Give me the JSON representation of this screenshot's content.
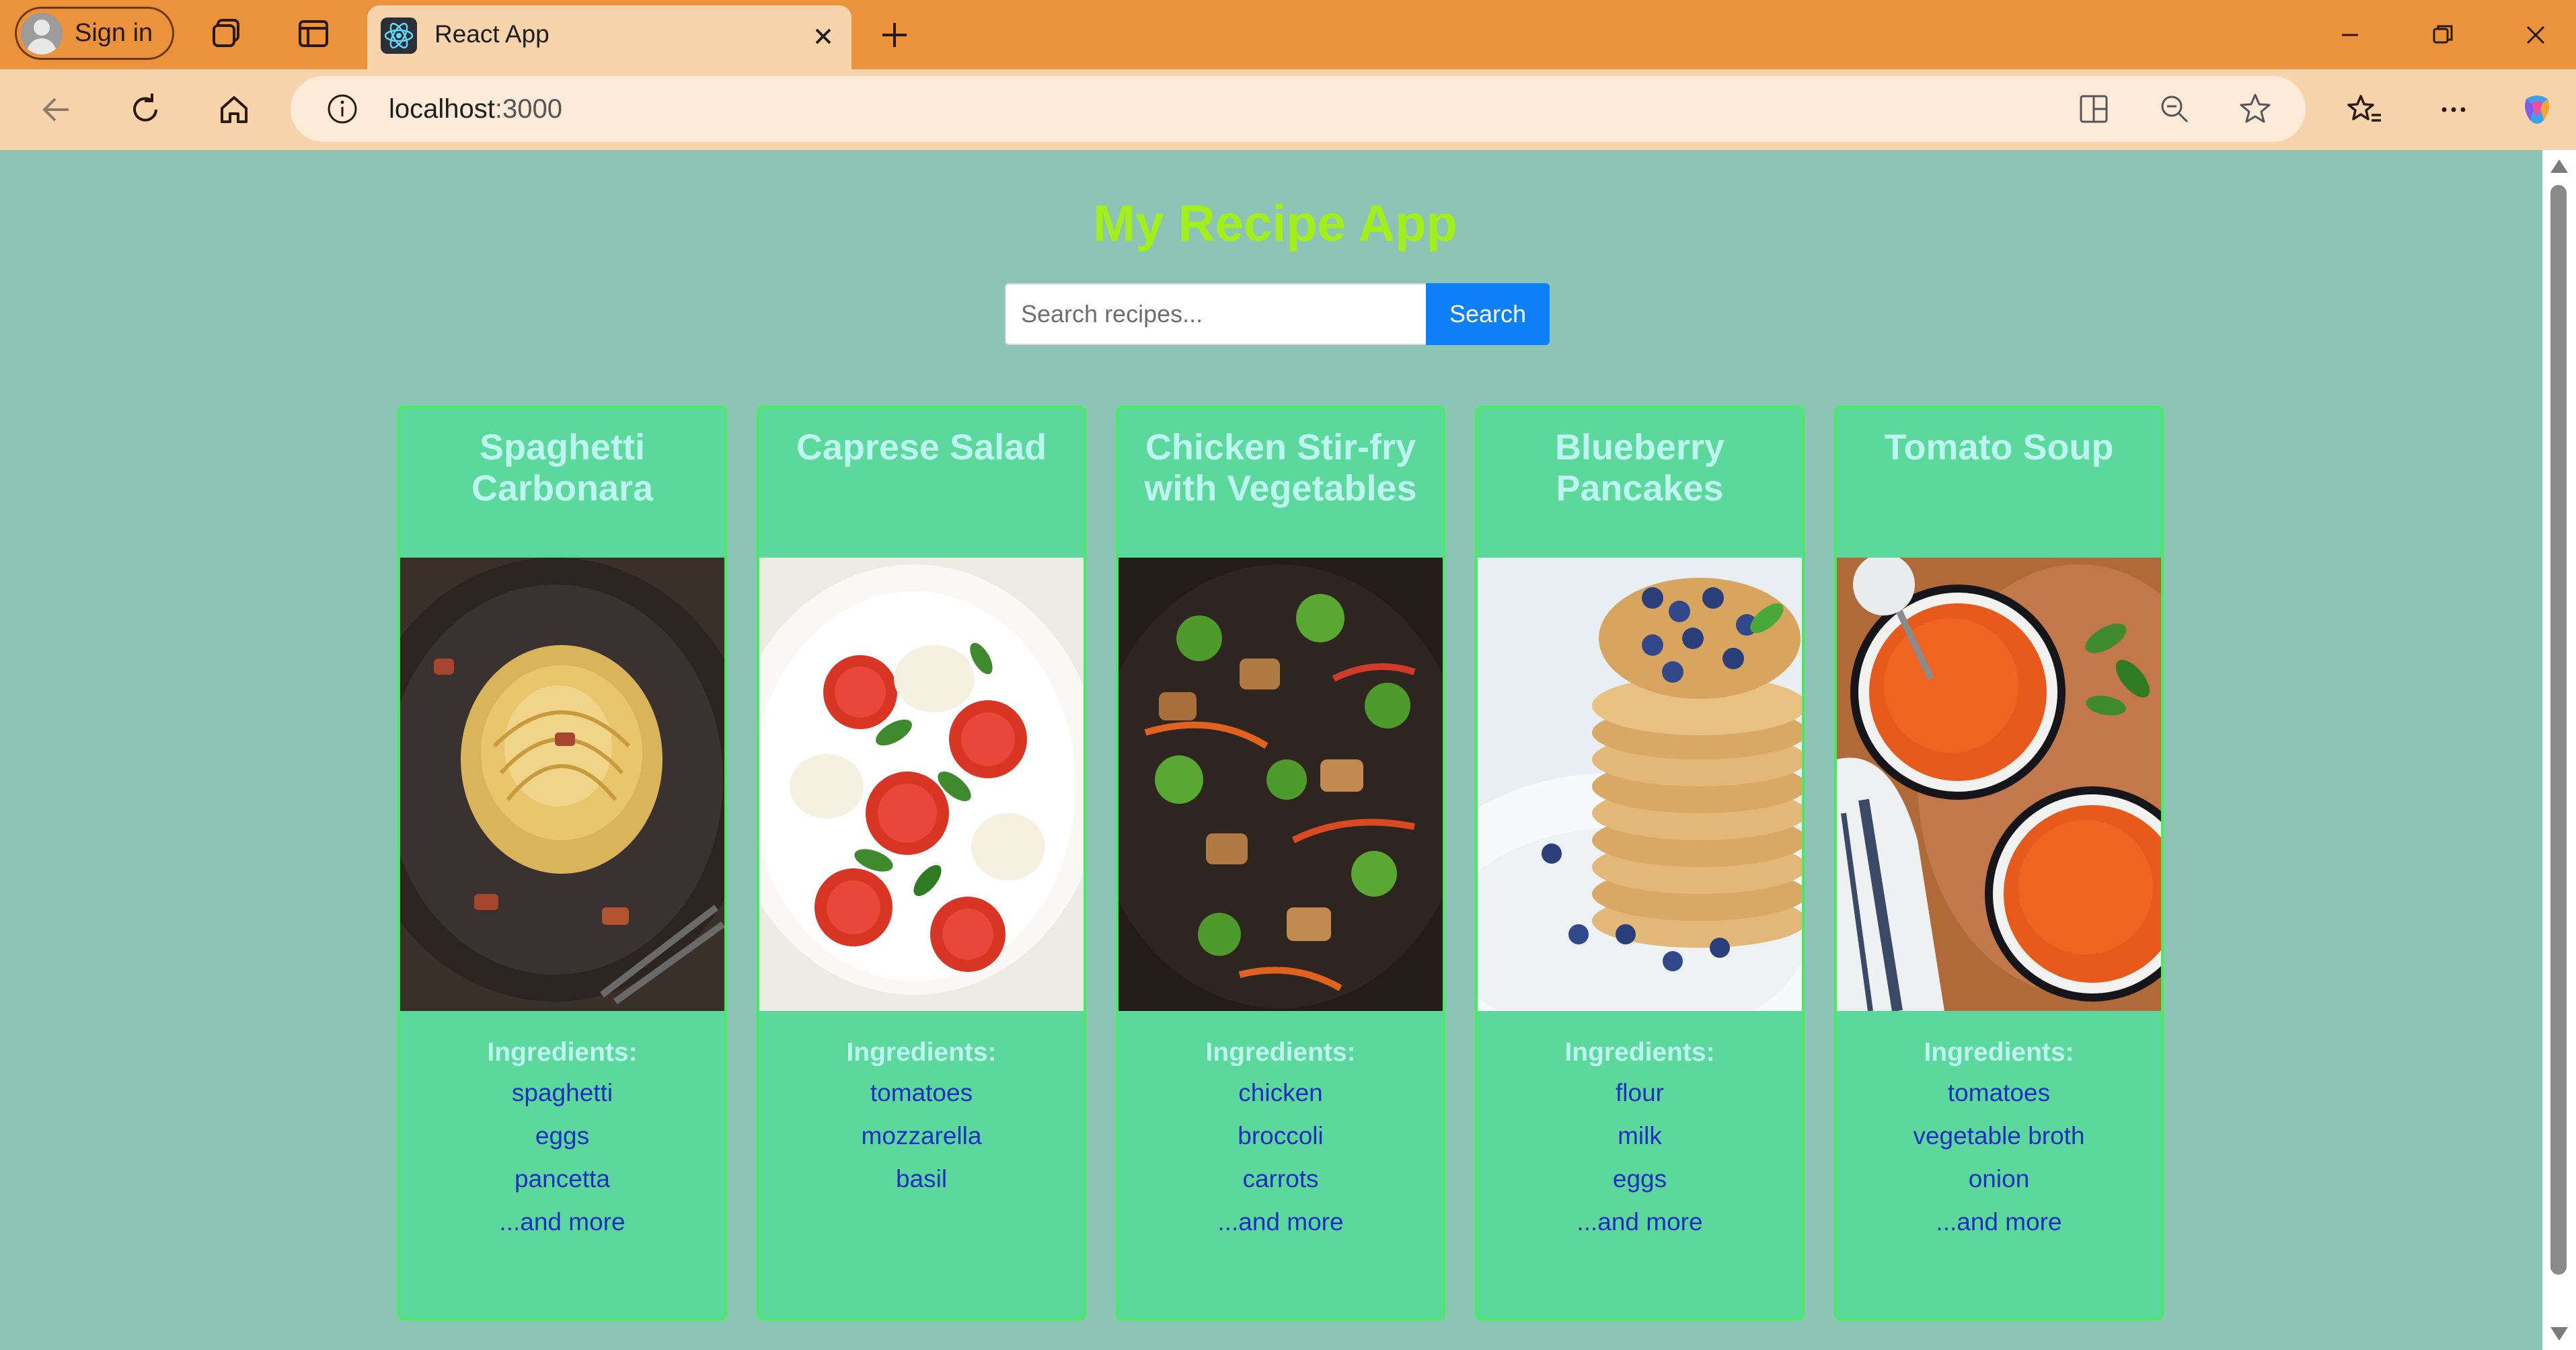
{
  "browser": {
    "sign_in_label": "Sign in",
    "tab": {
      "title": "React App"
    },
    "address": {
      "host": "localhost",
      "port": ":3000"
    },
    "icons": [
      "workspaces-icon",
      "tab-actions-icon",
      "react-favicon-icon",
      "close-tab-icon",
      "new-tab-icon",
      "minimize-icon",
      "restore-icon",
      "close-window-icon",
      "back-icon",
      "refresh-icon",
      "home-icon",
      "site-info-icon",
      "split-screen-icon",
      "zoom-out-icon",
      "favorite-star-icon",
      "favorites-icon",
      "more-options-icon",
      "copilot-icon"
    ],
    "colors": {
      "tabbar": "#eb923c",
      "toolbar": "#f8d4ad",
      "omnibox": "#fdebd9"
    }
  },
  "app": {
    "title": "My Recipe App",
    "search": {
      "placeholder": "Search recipes...",
      "value": "",
      "button_label": "Search"
    },
    "colors": {
      "background": "#8cc5b6",
      "title": "#a3ef1c",
      "card": "#5dd89c",
      "card_border": "#48ec62",
      "card_text": "#bdf6f1",
      "ingredient": "#1d2fc0",
      "button": "#0d7ff7"
    }
  },
  "recipes": [
    {
      "title": "Spaghetti Carbonara",
      "image": "spaghetti-carbonara-photo",
      "ingredients_label": "Ingredients:",
      "ingredients": [
        "spaghetti",
        "eggs",
        "pancetta",
        "...and more"
      ]
    },
    {
      "title": "Caprese Salad",
      "image": "caprese-salad-photo",
      "ingredients_label": "Ingredients:",
      "ingredients": [
        "tomatoes",
        "mozzarella",
        "basil",
        ""
      ]
    },
    {
      "title": "Chicken Stir-fry with Vegetables",
      "image": "chicken-stir-fry-photo",
      "ingredients_label": "Ingredients:",
      "ingredients": [
        "chicken",
        "broccoli",
        "carrots",
        "...and more"
      ]
    },
    {
      "title": "Blueberry Pancakes",
      "image": "blueberry-pancakes-photo",
      "ingredients_label": "Ingredients:",
      "ingredients": [
        "flour",
        "milk",
        "eggs",
        "...and more"
      ]
    },
    {
      "title": "Tomato Soup",
      "image": "tomato-soup-photo",
      "ingredients_label": "Ingredients:",
      "ingredients": [
        "tomatoes",
        "vegetable broth",
        "onion",
        "...and more"
      ]
    }
  ]
}
